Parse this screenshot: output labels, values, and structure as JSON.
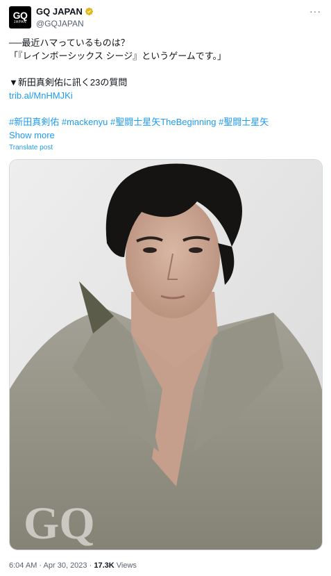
{
  "account": {
    "avatar_text": "GQ",
    "avatar_subtext": "JAPAN",
    "display_name": "GQ JAPAN",
    "handle": "@GQJAPAN"
  },
  "more_label": "···",
  "post": {
    "line1": "──最近ハマっているものは？",
    "line2": "「『レインボーシックス シージ』というゲームです。」",
    "line3": "▼新田真剣佑に訊く23の質問",
    "link": "trib.al/MnHMJKi",
    "hashtags": [
      "#新田真剣佑",
      "#mackenyu",
      "#聖闘士星矢TheBeginning",
      "#聖闘士星矢"
    ]
  },
  "show_more": "Show more",
  "translate": "Translate post",
  "media": {
    "watermark": "GQ"
  },
  "meta": {
    "time": "6:04 AM",
    "date": "Apr 30, 2023",
    "views_count": "17.3K",
    "views_label": "Views"
  },
  "colors": {
    "link": "#1d9bf0",
    "verified": "#e2b719",
    "secondary_text": "#536471"
  }
}
